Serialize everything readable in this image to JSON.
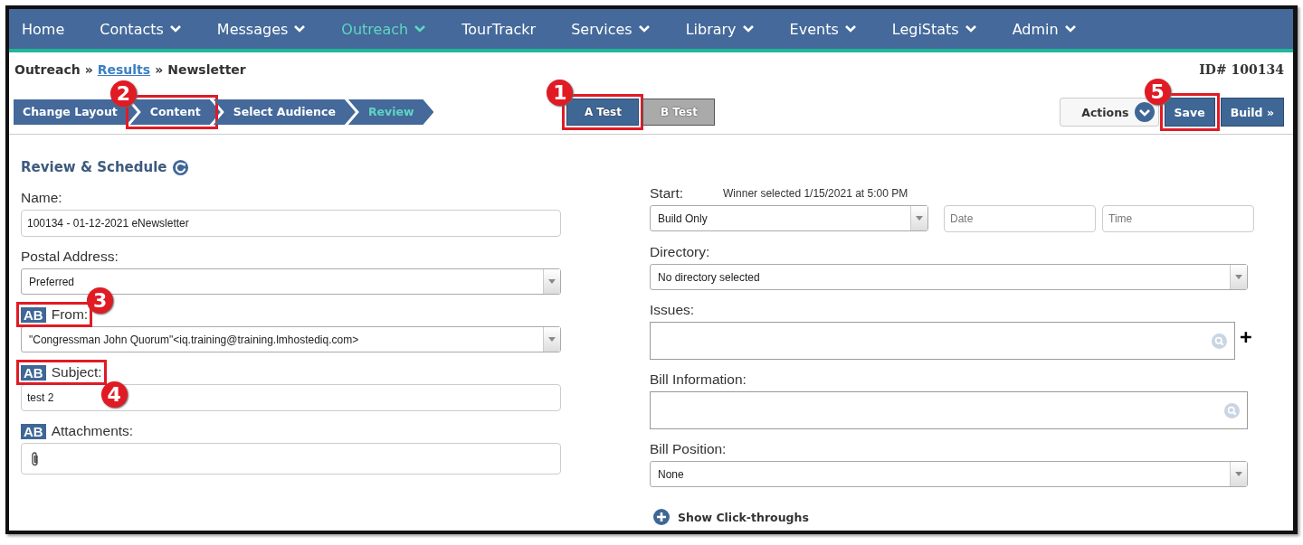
{
  "nav": [
    {
      "label": "Home",
      "dropdown": false,
      "selected": false
    },
    {
      "label": "Contacts",
      "dropdown": true,
      "selected": false
    },
    {
      "label": "Messages",
      "dropdown": true,
      "selected": false
    },
    {
      "label": "Outreach",
      "dropdown": true,
      "selected": true
    },
    {
      "label": "TourTrackr",
      "dropdown": false,
      "selected": false
    },
    {
      "label": "Services",
      "dropdown": true,
      "selected": false
    },
    {
      "label": "Library",
      "dropdown": true,
      "selected": false
    },
    {
      "label": "Events",
      "dropdown": true,
      "selected": false
    },
    {
      "label": "LegiStats",
      "dropdown": true,
      "selected": false
    },
    {
      "label": "Admin",
      "dropdown": true,
      "selected": false
    }
  ],
  "breadcrumb": {
    "items": [
      {
        "label": "Outreach",
        "link": false
      },
      {
        "label": "Results",
        "link": true
      },
      {
        "label": "Newsletter",
        "link": false
      }
    ],
    "separator": "»"
  },
  "record_id": "ID# 100134",
  "steps": [
    {
      "label": "Change Layout",
      "selected": false
    },
    {
      "label": "Content",
      "selected": false,
      "callout": {
        "number": "2",
        "right": false,
        "below": false
      }
    },
    {
      "label": "Select Audience",
      "selected": false
    },
    {
      "label": "Review",
      "selected": true
    }
  ],
  "ab_tests": [
    {
      "label": "A Test",
      "selected": true,
      "callout": {
        "number": "1",
        "right": false,
        "below": false
      }
    },
    {
      "label": "B Test",
      "selected": false
    }
  ],
  "actions": {
    "label": "Actions"
  },
  "save": {
    "label": "Save",
    "callout": {
      "number": "5",
      "right": false,
      "below": false
    }
  },
  "build": {
    "label": "Build »"
  },
  "section_title": "Review & Schedule",
  "left_fields": [
    {
      "label": "Name:",
      "kind": "text",
      "value": "100134 - 01-12-2021 eNewsletter"
    },
    {
      "label": "Postal Address:",
      "kind": "select",
      "value": "Preferred"
    },
    {
      "label": "From:",
      "badge": "AB",
      "kind": "select",
      "value": "\"Congressman John Quorum\"<iq.training@training.lmhostediq.com>",
      "callout": {
        "number": "3",
        "right": true,
        "below": false
      }
    },
    {
      "label": "Subject:",
      "badge": "AB",
      "kind": "text",
      "value": "test 2",
      "callout": {
        "number": "4",
        "right": true,
        "below": true
      }
    },
    {
      "label": "Attachments:",
      "badge": "AB",
      "kind": "attach"
    }
  ],
  "start": {
    "label": "Start:",
    "note": "Winner selected 1/15/2021 at 5:00 PM",
    "value": "Build Only",
    "date_placeholder": "Date",
    "time_placeholder": "Time"
  },
  "right_fields": [
    {
      "label": "Directory:",
      "kind": "select",
      "value": "No directory selected"
    },
    {
      "label": "Issues:",
      "kind": "lookup",
      "addable": true
    },
    {
      "label": "Bill Information:",
      "kind": "lookup",
      "addable": false
    },
    {
      "label": "Bill Position:",
      "kind": "select",
      "value": "None"
    }
  ],
  "show_click_throughs": "Show Click-throughs"
}
